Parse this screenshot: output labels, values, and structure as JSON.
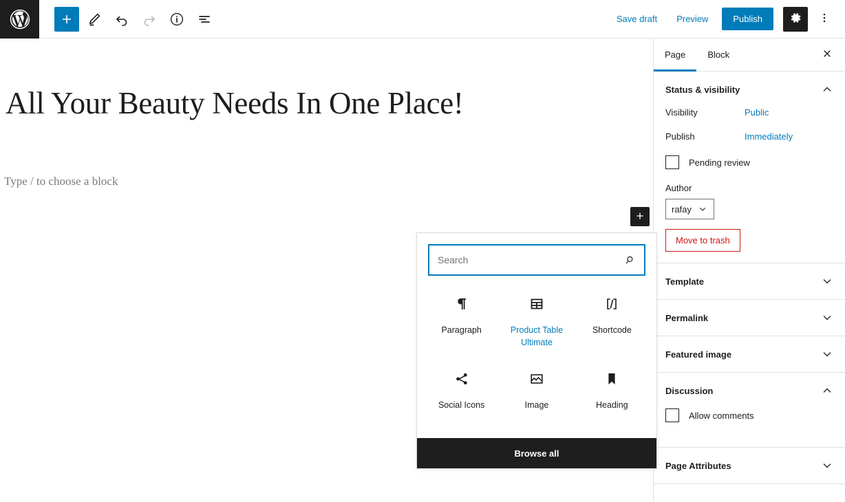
{
  "header": {
    "logo_icon": "wordpress-logo-icon",
    "tools": [
      {
        "name": "add-block-toggle",
        "icon": "plus-icon",
        "state": "primary"
      },
      {
        "name": "tools-pencil",
        "icon": "pencil-icon",
        "state": "default"
      },
      {
        "name": "undo",
        "icon": "undo-icon",
        "state": "default"
      },
      {
        "name": "redo",
        "icon": "redo-icon",
        "state": "disabled"
      },
      {
        "name": "details-info",
        "icon": "info-circle-icon",
        "state": "default"
      },
      {
        "name": "list-view",
        "icon": "list-view-icon",
        "state": "default"
      }
    ],
    "save_draft_label": "Save draft",
    "preview_label": "Preview",
    "publish_label": "Publish",
    "settings_icon": "gear-icon",
    "more_menu_icon": "kebab-menu-icon",
    "accent_color": "#007cba",
    "dark_color": "#1e1e1e"
  },
  "editor": {
    "title": "All Your Beauty Needs In One Place!",
    "block_placeholder": "Type / to choose a block",
    "add_block_icon": "plus-icon"
  },
  "inserter": {
    "search": {
      "value": "",
      "placeholder": "Search",
      "icon": "search-icon"
    },
    "blocks": [
      {
        "label": "Paragraph",
        "icon": "paragraph-icon",
        "highlighted": false
      },
      {
        "label": "Product Table Ultimate",
        "icon": "table-icon",
        "highlighted": true
      },
      {
        "label": "Shortcode",
        "icon": "shortcode-icon",
        "highlighted": false
      },
      {
        "label": "Social Icons",
        "icon": "share-icon",
        "highlighted": false
      },
      {
        "label": "Image",
        "icon": "image-icon",
        "highlighted": false
      },
      {
        "label": "Heading",
        "icon": "bookmark-icon",
        "highlighted": false
      }
    ],
    "browse_all_label": "Browse all"
  },
  "sidebar": {
    "tabs": [
      {
        "label": "Page",
        "active": true
      },
      {
        "label": "Block",
        "active": false
      }
    ],
    "close_icon": "close-icon",
    "panels": {
      "status": {
        "title": "Status & visibility",
        "expanded": true,
        "visibility_label": "Visibility",
        "visibility_value": "Public",
        "publish_label": "Publish",
        "publish_value": "Immediately",
        "pending_review_label": "Pending review",
        "pending_review_checked": false,
        "author_label": "Author",
        "author_value": "rafay",
        "trash_label": "Move to trash",
        "trash_color": "#cc1818"
      },
      "template": {
        "title": "Template",
        "expanded": false
      },
      "permalink": {
        "title": "Permalink",
        "expanded": false
      },
      "featured_image": {
        "title": "Featured image",
        "expanded": false
      },
      "discussion": {
        "title": "Discussion",
        "expanded": true,
        "allow_comments_label": "Allow comments",
        "allow_comments_checked": false
      },
      "page_attributes": {
        "title": "Page Attributes",
        "expanded": false
      }
    }
  }
}
